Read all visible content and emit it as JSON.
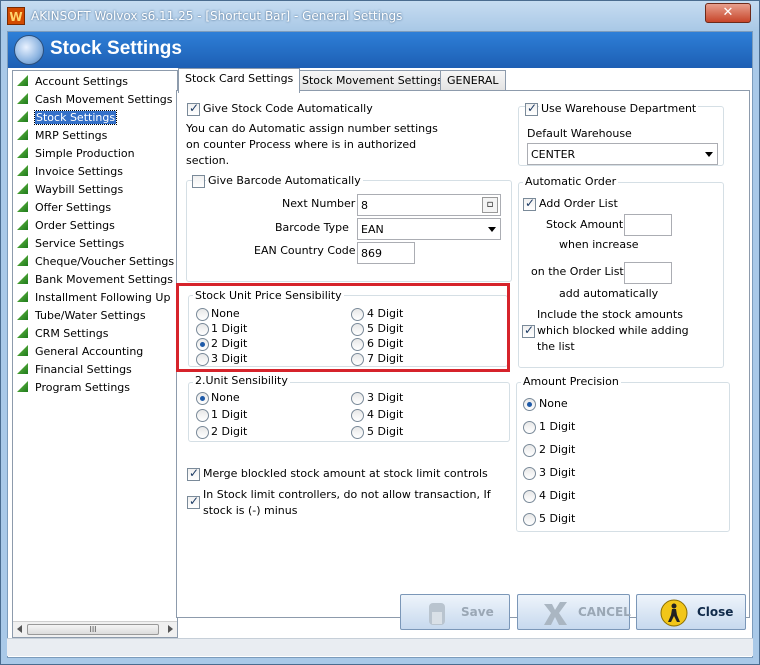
{
  "window": {
    "title": "AKINSOFT Wolvox s6.11.25 - [Shortcut Bar] - General Settings",
    "close_label": "✕"
  },
  "header": {
    "title": "Stock Settings"
  },
  "sidebar": {
    "items": [
      {
        "label": "Account Settings",
        "selected": false
      },
      {
        "label": "Cash Movement Settings",
        "selected": false
      },
      {
        "label": "Stock Settings",
        "selected": true
      },
      {
        "label": "MRP Settings",
        "selected": false
      },
      {
        "label": "Simple Production",
        "selected": false
      },
      {
        "label": "Invoice Settings",
        "selected": false
      },
      {
        "label": "Waybill Settings",
        "selected": false
      },
      {
        "label": "Offer Settings",
        "selected": false
      },
      {
        "label": "Order Settings",
        "selected": false
      },
      {
        "label": "Service Settings",
        "selected": false
      },
      {
        "label": "Cheque/Voucher Settings",
        "selected": false
      },
      {
        "label": "Bank Movement Settings",
        "selected": false
      },
      {
        "label": "Installment Following Up",
        "selected": false
      },
      {
        "label": "Tube/Water Settings",
        "selected": false
      },
      {
        "label": "CRM Settings",
        "selected": false
      },
      {
        "label": "General Accounting",
        "selected": false
      },
      {
        "label": "Financial Settings",
        "selected": false
      },
      {
        "label": "Program Settings",
        "selected": false
      }
    ],
    "scroll_grip": "III"
  },
  "tabs": [
    {
      "label": "Stock Card Settings",
      "active": true
    },
    {
      "label": "Stock Movement Settings",
      "active": false
    },
    {
      "label": "GENERAL",
      "active": false
    }
  ],
  "stock_card": {
    "give_stock_code": {
      "label": "Give Stock Code Automatically",
      "checked": true
    },
    "info_line1": "You can do Automatic assign number settings",
    "info_line2": "on counter Process where is in authorized",
    "info_line3": "section.",
    "give_barcode": {
      "label": "Give Barcode Automatically",
      "checked": false
    },
    "next_number": {
      "label": "Next Number",
      "value": "8"
    },
    "barcode_type": {
      "label": "Barcode Type",
      "value": "EAN"
    },
    "ean_country_code": {
      "label": "EAN Country Code",
      "value": "869"
    },
    "use_warehouse": {
      "label": "Use Warehouse Department",
      "checked": true
    },
    "default_warehouse": {
      "label": "Default Warehouse",
      "value": "CENTER"
    },
    "automatic_order": {
      "title": "Automatic Order",
      "add_order_list": {
        "label": "Add Order List",
        "checked": true
      },
      "stock_amount_line1": "Stock Amount",
      "stock_amount_line2": "when increase",
      "stock_amount_value": "",
      "order_list_line1": "on the Order List",
      "order_list_line2": "add automatically",
      "order_list_value": "",
      "include_blocked": {
        "line1": "Include the stock amounts",
        "line2": "which blocked while adding",
        "line3": "the list",
        "checked": true
      }
    },
    "unit_price_sensibility": {
      "title": "Stock Unit Price Sensibility",
      "options": [
        "None",
        "1 Digit",
        "2 Digit",
        "3 Digit",
        "4 Digit",
        "5 Digit",
        "6 Digit",
        "7 Digit"
      ],
      "selected": "2 Digit"
    },
    "unit_sensibility": {
      "title": "2.Unit Sensibility",
      "options": [
        "None",
        "1 Digit",
        "2 Digit",
        "3 Digit",
        "4 Digit",
        "5 Digit"
      ],
      "selected": "None"
    },
    "amount_precision": {
      "title": "Amount Precision",
      "options": [
        "None",
        "1 Digit",
        "2 Digit",
        "3 Digit",
        "4 Digit",
        "5 Digit"
      ],
      "selected": "None"
    },
    "merge_blocked": {
      "label": "Merge blockled stock amount at stock limit controls",
      "checked": true
    },
    "stock_limit_minus": {
      "line1": "In Stock limit controllers, do not allow transaction, If",
      "line2": "stock is (-) minus",
      "checked": true
    }
  },
  "buttons": {
    "save": "Save",
    "cancel": "CANCEL",
    "close": "Close"
  },
  "colors": {
    "header_band": "#1d5fb4",
    "highlight_border": "#d6232b",
    "selection": "#3470c8"
  }
}
